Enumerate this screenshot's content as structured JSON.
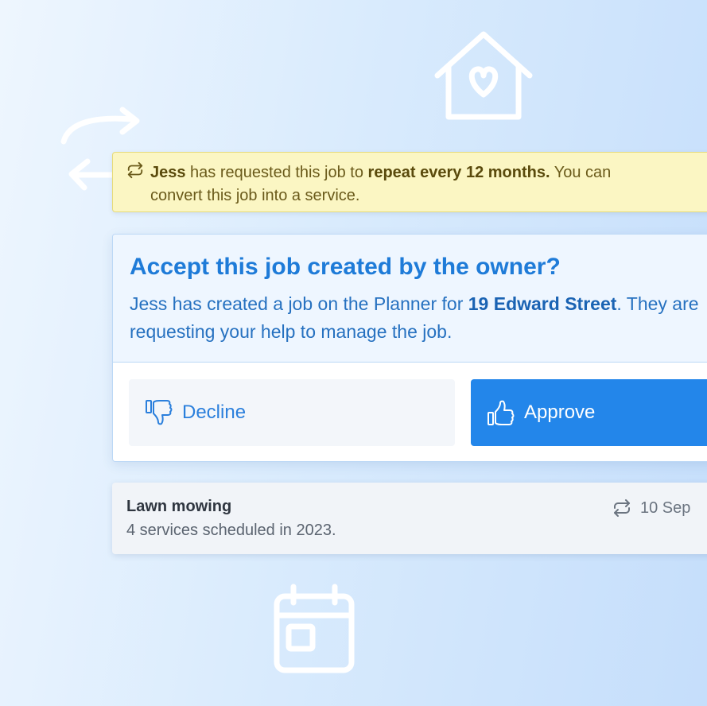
{
  "decor": {
    "home_icon": "home-heart-icon",
    "arrows_icon": "swap-arrows-icon",
    "calendar_icon": "calendar-icon"
  },
  "notice": {
    "icon": "repeat-icon",
    "name": "Jess",
    "text1": " has requested this job to ",
    "emphasis": "repeat every 12 months.",
    "text2": " You can convert this job into a service."
  },
  "request_card": {
    "title": "Accept this job created by the owner?",
    "desc_pre": "Jess has created a job on the Planner for ",
    "address": "19 Edward Street",
    "desc_post": ". They are requesting your help to manage the job.",
    "decline_label": "Decline",
    "decline_icon": "thumbs-down-icon",
    "approve_label": "Approve",
    "approve_icon": "thumbs-up-icon"
  },
  "service_row": {
    "name": "Lawn mowing",
    "subtitle": "4 services scheduled in 2023.",
    "date": "10 Sep",
    "date_icon": "repeat-icon"
  },
  "colors": {
    "accent": "#2386ea",
    "title_blue": "#1e7bd8",
    "notice_bg": "#fbf6c3",
    "row_bg": "#f1f4f8"
  }
}
